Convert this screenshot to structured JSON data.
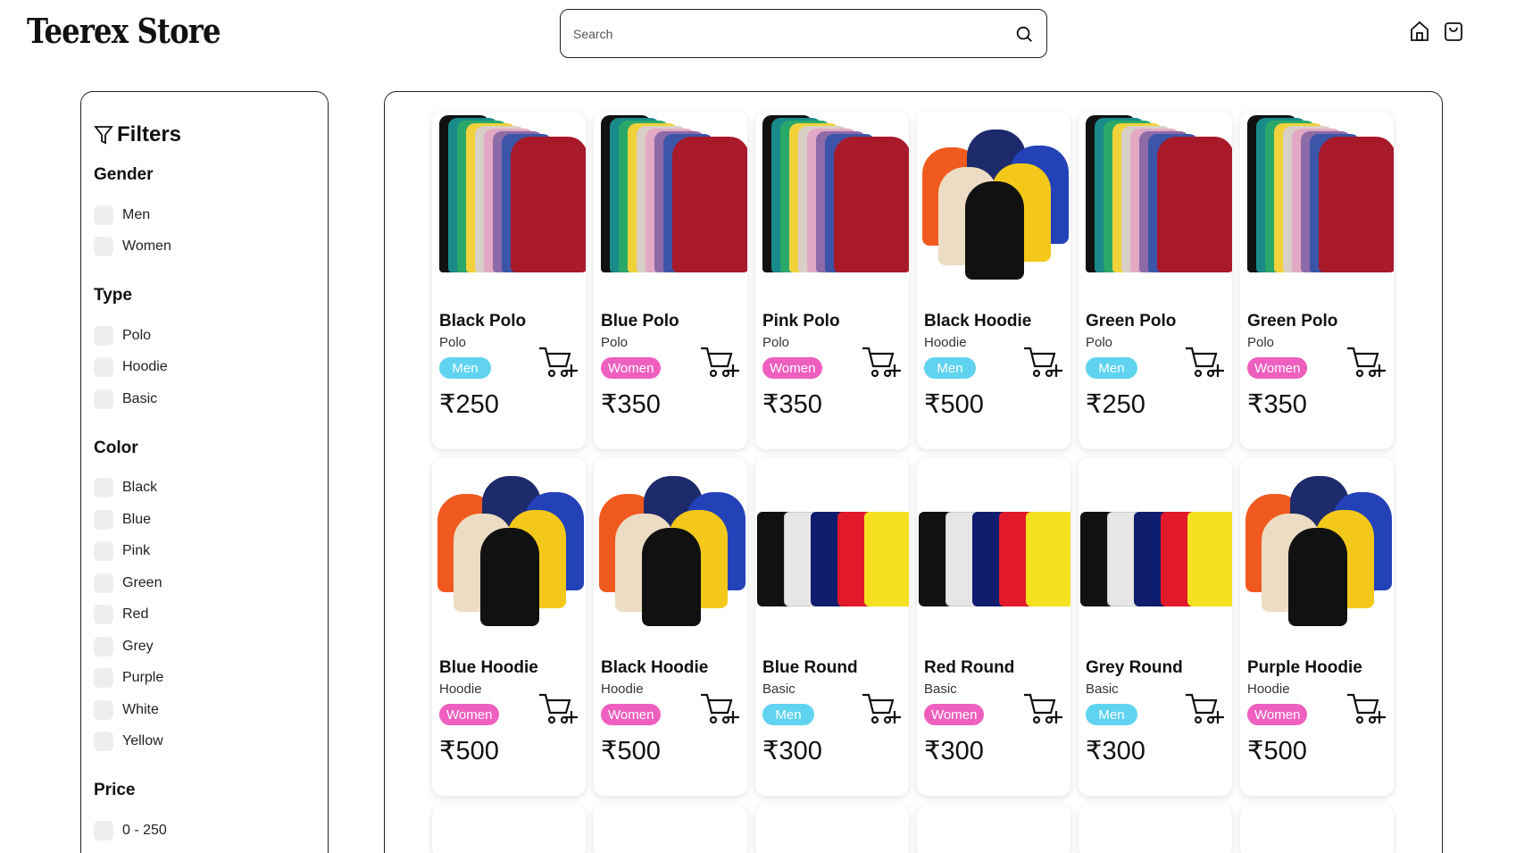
{
  "header": {
    "logo": "Teerex Store",
    "search_placeholder": "Search"
  },
  "filters": {
    "title": "Filters",
    "groups": [
      {
        "title": "Gender",
        "options": [
          "Men",
          "Women"
        ]
      },
      {
        "title": "Type",
        "options": [
          "Polo",
          "Hoodie",
          "Basic"
        ]
      },
      {
        "title": "Color",
        "options": [
          "Black",
          "Blue",
          "Pink",
          "Green",
          "Red",
          "Grey",
          "Purple",
          "White",
          "Yellow"
        ]
      },
      {
        "title": "Price",
        "options": [
          "0 - 250"
        ]
      }
    ]
  },
  "products": [
    {
      "name": "Black Polo",
      "type": "Polo",
      "gender": "Men",
      "price": "₹250",
      "image": "polo"
    },
    {
      "name": "Blue Polo",
      "type": "Polo",
      "gender": "Women",
      "price": "₹350",
      "image": "polo"
    },
    {
      "name": "Pink Polo",
      "type": "Polo",
      "gender": "Women",
      "price": "₹350",
      "image": "polo"
    },
    {
      "name": "Black Hoodie",
      "type": "Hoodie",
      "gender": "Men",
      "price": "₹500",
      "image": "hoodie"
    },
    {
      "name": "Green Polo",
      "type": "Polo",
      "gender": "Men",
      "price": "₹250",
      "image": "polo"
    },
    {
      "name": "Green Polo",
      "type": "Polo",
      "gender": "Women",
      "price": "₹350",
      "image": "polo"
    },
    {
      "name": "Blue Hoodie",
      "type": "Hoodie",
      "gender": "Women",
      "price": "₹500",
      "image": "hoodie"
    },
    {
      "name": "Black Hoodie",
      "type": "Hoodie",
      "gender": "Women",
      "price": "₹500",
      "image": "hoodie"
    },
    {
      "name": "Blue Round",
      "type": "Basic",
      "gender": "Men",
      "price": "₹300",
      "image": "round"
    },
    {
      "name": "Red Round",
      "type": "Basic",
      "gender": "Women",
      "price": "₹300",
      "image": "round"
    },
    {
      "name": "Grey Round",
      "type": "Basic",
      "gender": "Men",
      "price": "₹300",
      "image": "round"
    },
    {
      "name": "Purple Hoodie",
      "type": "Hoodie",
      "gender": "Women",
      "price": "₹500",
      "image": "hoodie"
    }
  ],
  "colors": {
    "men_badge": "#5fd3f0",
    "women_badge": "#ee5fbf"
  },
  "icons": {
    "search": "search-icon",
    "home": "home-icon",
    "bag": "shopping-bag-icon",
    "filter": "filter-icon",
    "cart": "add-to-cart-icon"
  }
}
